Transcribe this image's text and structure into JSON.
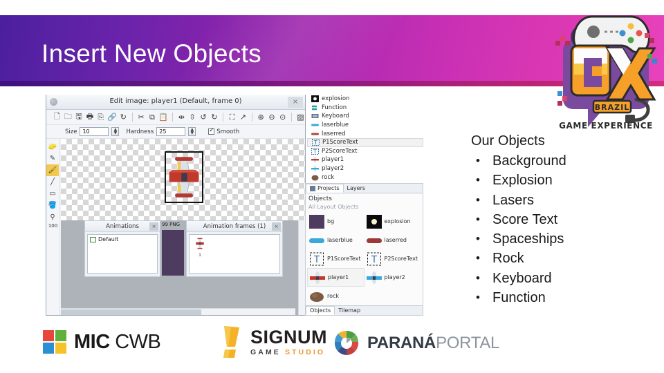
{
  "slide": {
    "title": "Insert New Objects",
    "header_gradient": [
      "#4b1f9e",
      "#e842bc"
    ]
  },
  "brand_logo": {
    "name": "gx-brazil-logo",
    "letters": "GX",
    "badge": "BRAZIL",
    "tagline": "GAME EXPERIENCE",
    "colors": {
      "orange": "#f6a02a",
      "yellow": "#fbc94a",
      "purple": "#7a4a9e",
      "dark": "#2b2b2b"
    }
  },
  "objects_panel": {
    "heading": "Our Objects",
    "bullet": "•",
    "items": [
      "Background",
      "Explosion",
      "Lasers",
      "Score Text",
      "Spaceships",
      "Rock",
      "Keyboard",
      "Function"
    ]
  },
  "screenshot": {
    "editor_window": {
      "title": "Edit image: player1 (Default, frame 0)",
      "close_label": "×",
      "toolbar_icons": [
        "new-file-icon",
        "open-folder-icon",
        "save-icon",
        "save-as-icon",
        "export-icon",
        "link-icon",
        "refresh-icon",
        "cut-icon",
        "copy-icon",
        "paste-icon",
        "mirror-horizontal-icon",
        "flip-vertical-icon",
        "undo-icon",
        "redo-icon",
        "crop-icon",
        "resize-icon",
        "zoom-in-icon",
        "zoom-out-icon",
        "zoom-reset-icon",
        "transparency-icon"
      ],
      "options": {
        "size_label": "Size",
        "size_value": "10",
        "hardness_label": "Hardness",
        "hardness_value": "25",
        "smooth_label": "Smooth",
        "smooth_checked": true
      },
      "tools": [
        "eraser-icon",
        "pencil-icon",
        "brush-icon",
        "line-icon",
        "rectangle-icon",
        "fill-icon",
        "eyedropper-icon"
      ],
      "zoom_level": "100",
      "animations_panel": {
        "title": "Animations",
        "close_label": "×",
        "items": [
          "Default"
        ]
      },
      "frames_panel": {
        "title": "Animation frames (1)",
        "close_label": "×",
        "frame_label": "1"
      },
      "format_label": "99  PNG"
    },
    "type_list": [
      {
        "label": "explosion",
        "icon": "sprite-icon",
        "selected": false
      },
      {
        "label": "Function",
        "icon": "function-icon",
        "selected": false
      },
      {
        "label": "Keyboard",
        "icon": "keyboard-icon",
        "selected": false
      },
      {
        "label": "laserblue",
        "icon": "sprite-icon",
        "selected": false
      },
      {
        "label": "laserred",
        "icon": "sprite-icon",
        "selected": false
      },
      {
        "label": "P1ScoreText",
        "icon": "text-object-icon",
        "selected": true
      },
      {
        "label": "P2ScoreText",
        "icon": "text-object-icon",
        "selected": false
      },
      {
        "label": "player1",
        "icon": "sprite-icon",
        "selected": false
      },
      {
        "label": "player2",
        "icon": "sprite-icon",
        "selected": false
      },
      {
        "label": "rock",
        "icon": "sprite-icon",
        "selected": false
      }
    ],
    "projects_panel": {
      "tabs": [
        {
          "label": "Projects",
          "active": true
        },
        {
          "label": "Layers",
          "active": false
        }
      ],
      "section_title": "Objects",
      "section_subtitle": "All Layout Objects",
      "objects": [
        {
          "label": "bg",
          "selected": false
        },
        {
          "label": "explosion",
          "selected": false
        },
        {
          "label": "laserblue",
          "selected": false
        },
        {
          "label": "laserred",
          "selected": false
        },
        {
          "label": "P1ScoreText",
          "selected": false
        },
        {
          "label": "P2ScoreText",
          "selected": false
        },
        {
          "label": "player1",
          "selected": true
        },
        {
          "label": "player2",
          "selected": false
        },
        {
          "label": "rock",
          "selected": false
        }
      ],
      "bottom_tabs": [
        {
          "label": "Objects",
          "active": true
        },
        {
          "label": "Tilemap",
          "active": false
        }
      ]
    }
  },
  "footer_logos": {
    "mic": {
      "bold": "MIC",
      "light": " CWB",
      "squares": [
        "#e8463a",
        "#62b03c",
        "#2a8fd4",
        "#f5c22a"
      ]
    },
    "signum": {
      "name": "SIGNUM",
      "game": "GAME",
      "studio": "STUDIO",
      "mark_color": "#f5b127"
    },
    "parana": {
      "bold": "PARANÁ",
      "light": "PORTAL"
    }
  }
}
